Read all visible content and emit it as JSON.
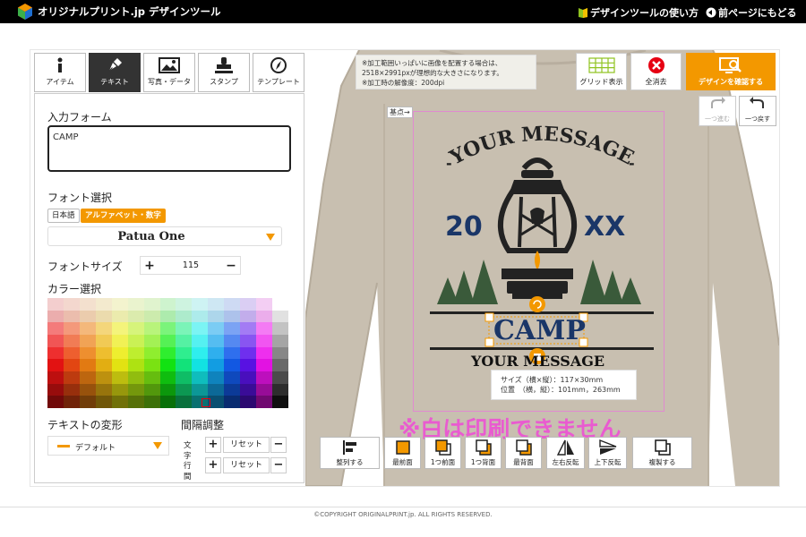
{
  "header": {
    "title": "オリジナルプリント.jp デザインツール",
    "how_to": "デザインツールの使い方",
    "back": "前ページにもどる"
  },
  "tabs": [
    {
      "label": "アイテム",
      "icon": "info-icon"
    },
    {
      "label": "テキスト",
      "icon": "pen-icon",
      "active": true
    },
    {
      "label": "写真・データ",
      "icon": "image-icon"
    },
    {
      "label": "スタンプ",
      "icon": "stamp-icon"
    },
    {
      "label": "テンプレート",
      "icon": "compass-icon"
    }
  ],
  "panel": {
    "input_label": "入力フォーム",
    "input_value": "CAMP",
    "font_label": "フォント選択",
    "font_tabs": [
      "日本語",
      "アルファベット・数字"
    ],
    "font_value": "Patua One",
    "size_label": "フォントサイズ",
    "size_value": "115",
    "color_label": "カラー選択",
    "transform_label": "テキストの変形",
    "transform_value": "デフォルト",
    "spacing_label": "間隔調整",
    "spacing_rows": [
      {
        "label": "文字",
        "reset": "リセット"
      },
      {
        "label": "行間",
        "reset": "リセット"
      }
    ]
  },
  "canvas": {
    "note_lines": [
      "※加工範囲いっぱいに画像を配置する場合は、",
      "2518×2991pxが理想的な大きさになります。",
      "※加工時の解像度：200dpi"
    ],
    "grid_label": "グリッド表示",
    "clear_label": "全消去",
    "confirm_label": "デザインを確認する",
    "undo_label": "一つ進む",
    "redo_label": "一つ戻す",
    "base_label": "基点→",
    "design": {
      "top_text": "YOUR MESSAGE",
      "year_left": "20",
      "year_right": "XX",
      "main_text": "CAMP",
      "bottom_text": "YOUR MESSAGE"
    },
    "info_size": "サイズ（横×縦）：117×30mm",
    "info_position": "位置　（横，縦）：101mm，263mm",
    "warning": "※白は印刷できません",
    "colors": {
      "accent": "#f39800",
      "shirt": "#c8bfb0",
      "navy": "#1a3668",
      "green": "#3a5a3a",
      "warning": "#e95bd0"
    }
  },
  "bottom_tools": [
    {
      "label": "整列する",
      "icon": "align-icon"
    },
    {
      "label": "最前面",
      "icon": "front-icon"
    },
    {
      "label": "1つ前面",
      "icon": "forward-icon"
    },
    {
      "label": "1つ背面",
      "icon": "backward-icon"
    },
    {
      "label": "最背面",
      "icon": "back-icon"
    },
    {
      "label": "左右反転",
      "icon": "flip-h-icon"
    },
    {
      "label": "上下反転",
      "icon": "flip-v-icon"
    },
    {
      "label": "複製する",
      "icon": "duplicate-icon"
    }
  ],
  "footer": {
    "copyright": "©COPYRIGHT ORIGINALPRINT.jp. ALL RIGHTS RESERVED."
  }
}
